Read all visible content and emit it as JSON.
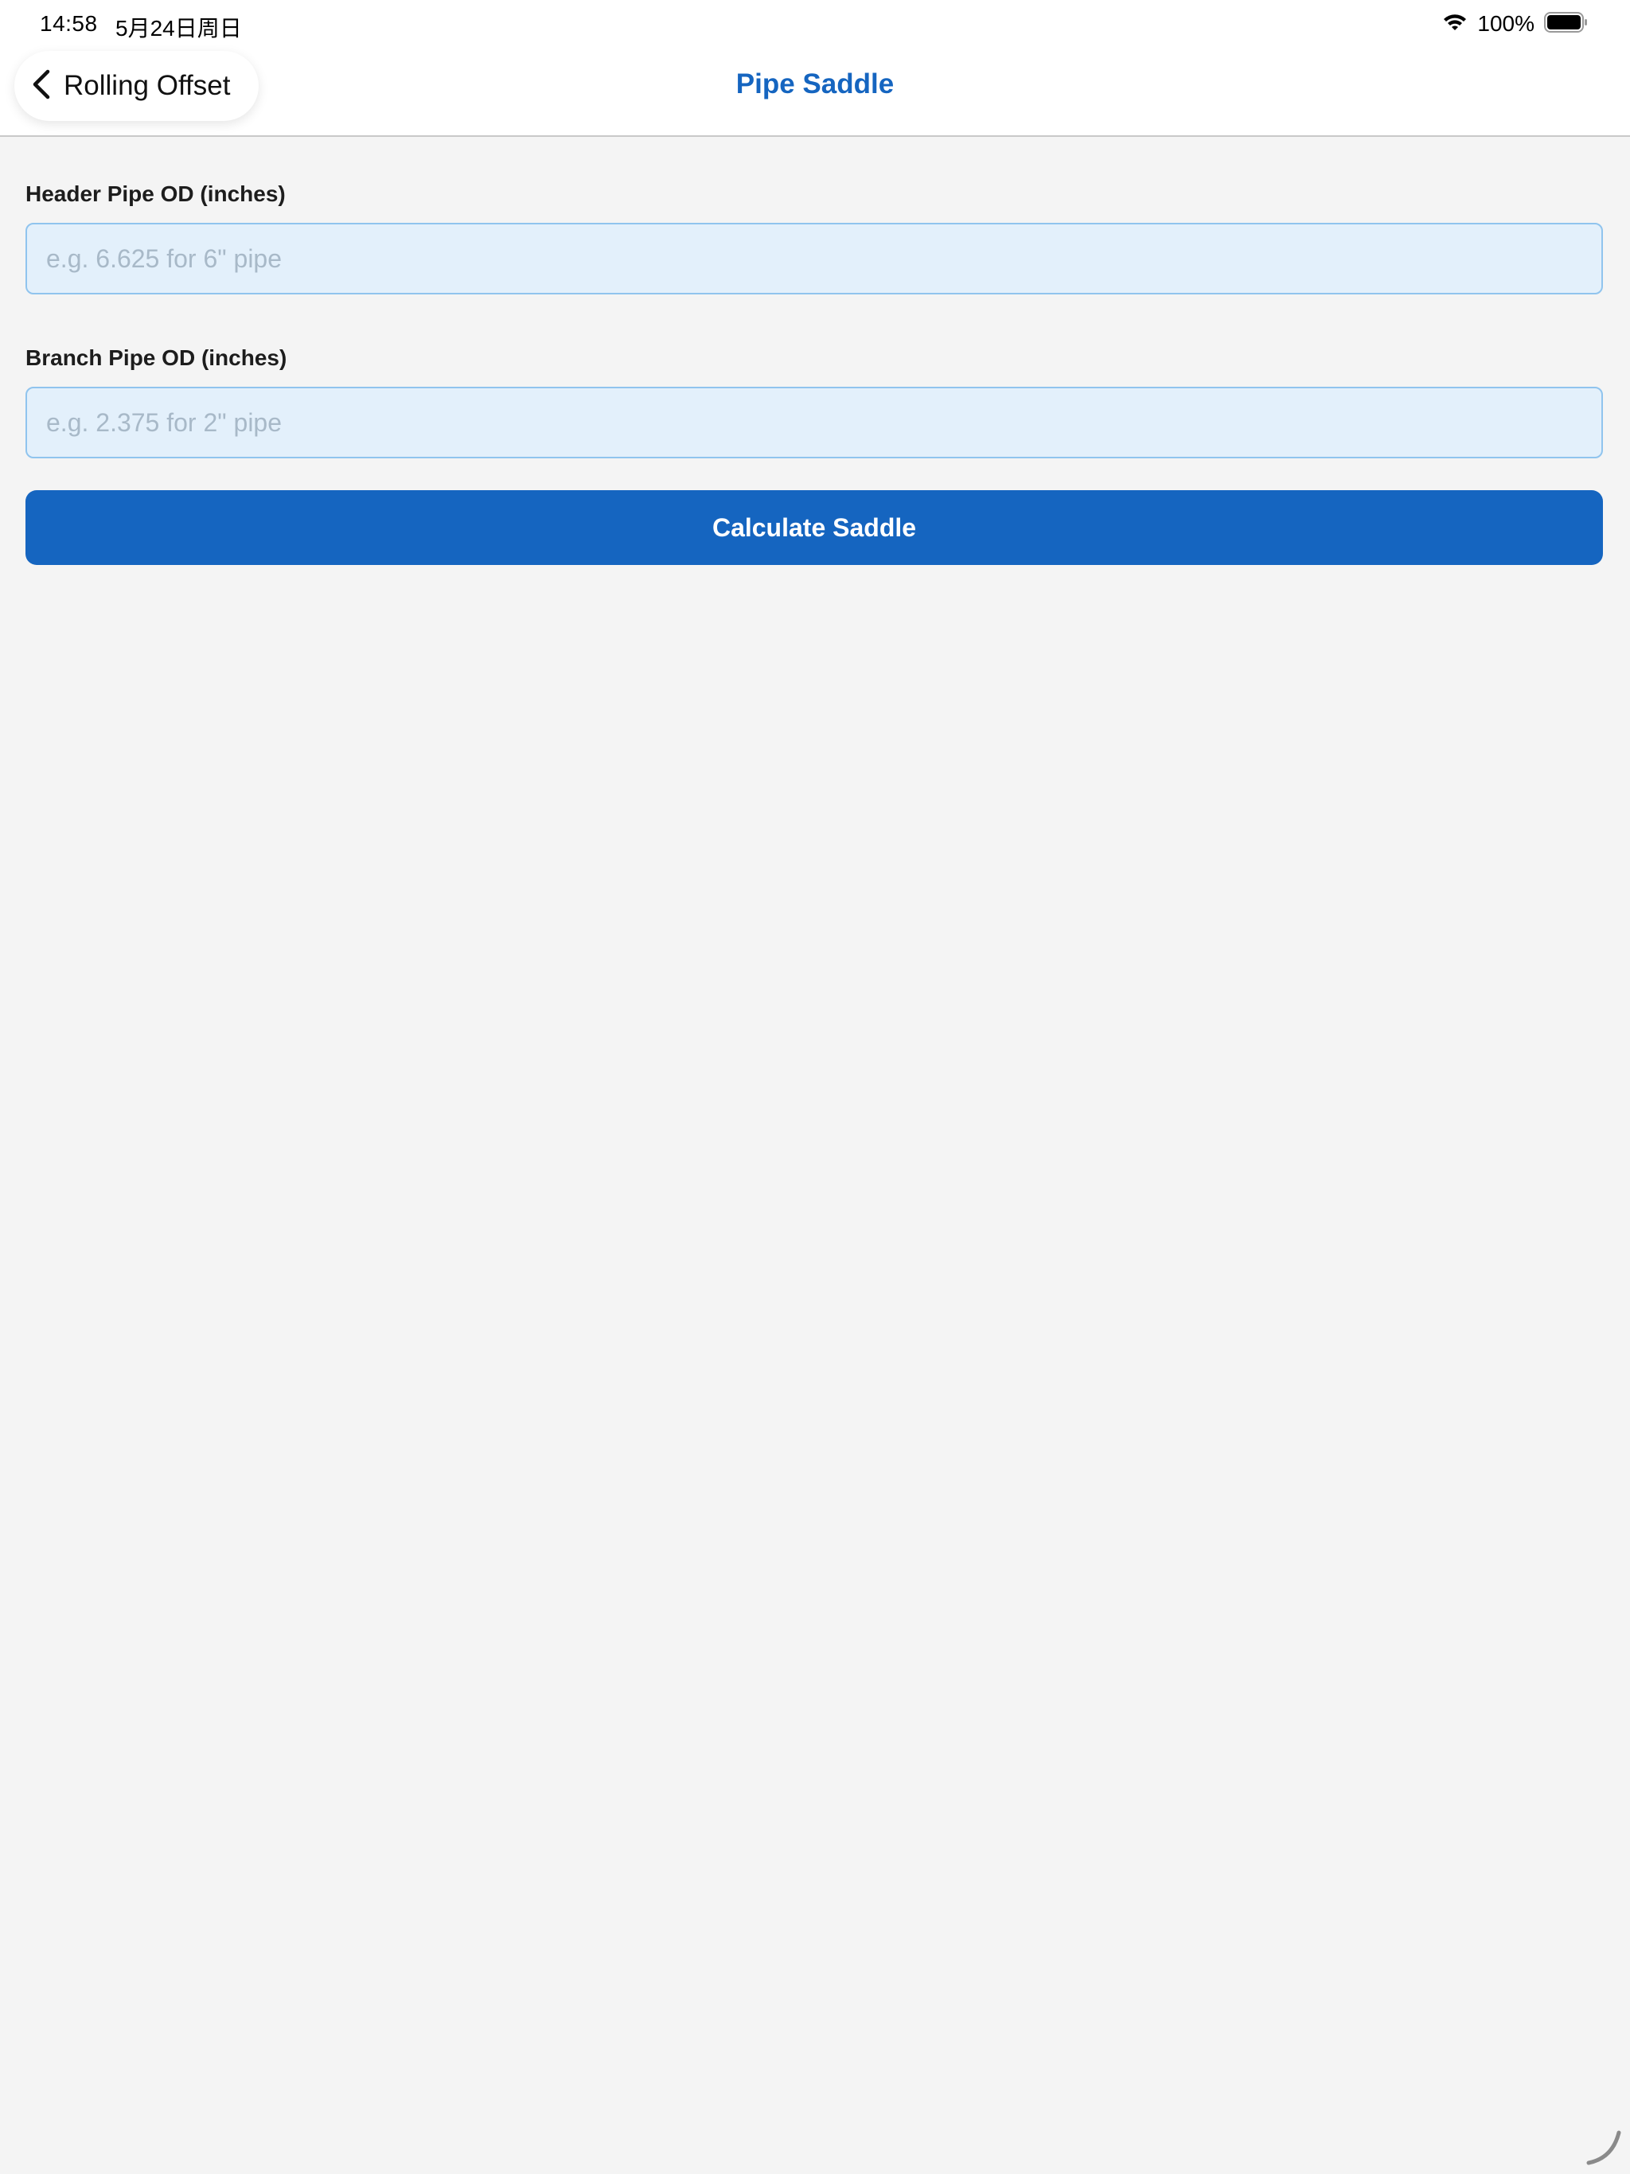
{
  "status_bar": {
    "time": "14:58",
    "date": "5月24日周日",
    "battery_percent": "100%",
    "wifi_icon": "wifi-icon",
    "battery_icon": "battery-full-icon"
  },
  "nav": {
    "back_label": "Rolling Offset",
    "back_icon": "chevron-left-icon",
    "title": "Pipe Saddle"
  },
  "form": {
    "header_pipe": {
      "label": "Header Pipe OD (inches)",
      "value": "",
      "placeholder": "e.g. 6.625 for 6\" pipe"
    },
    "branch_pipe": {
      "label": "Branch Pipe OD (inches)",
      "value": "",
      "placeholder": "e.g. 2.375 for 2\" pipe"
    },
    "submit_label": "Calculate Saddle"
  },
  "colors": {
    "accent": "#1565c0",
    "page_background": "#f4f4f4",
    "input_background": "#e3f0fb",
    "input_border": "#90c4ee"
  }
}
